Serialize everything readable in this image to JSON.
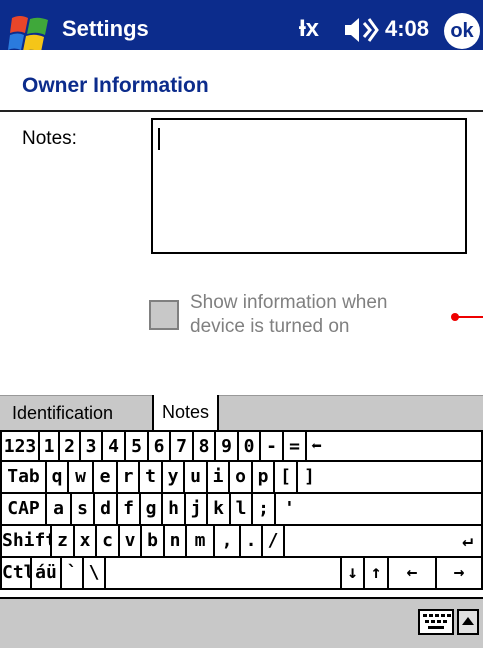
{
  "titlebar": {
    "title": "Settings",
    "time": "4:08",
    "ok_label": "ok",
    "connectivity": "Ɨx"
  },
  "page": {
    "header": "Owner Information"
  },
  "notes": {
    "label": "Notes:",
    "value": ""
  },
  "checkbox": {
    "line1": "Show information when",
    "line2": "device is turned on",
    "checked": false
  },
  "tabs": [
    {
      "label": "Identification",
      "active": false
    },
    {
      "label": "Notes",
      "active": true
    }
  ],
  "keyboard": {
    "rows": [
      [
        "123",
        "1",
        "2",
        "3",
        "4",
        "5",
        "6",
        "7",
        "8",
        "9",
        "0",
        "-",
        "=",
        "⬅"
      ],
      [
        "Tab",
        "q",
        "w",
        "e",
        "r",
        "t",
        "y",
        "u",
        "i",
        "o",
        "p",
        "[",
        "]"
      ],
      [
        "CAP",
        "a",
        "s",
        "d",
        "f",
        "g",
        "h",
        "j",
        "k",
        "l",
        ";",
        "'"
      ],
      [
        "Shift",
        "z",
        "x",
        "c",
        "v",
        "b",
        "n",
        "m",
        ",",
        ".",
        "/",
        "↵"
      ],
      [
        "Ctl",
        "áü",
        "`",
        "\\",
        "",
        "↓",
        "↑",
        "←",
        "→"
      ]
    ]
  },
  "colors": {
    "titlebar": "#0c2c8c",
    "header_text": "#0c2c8c",
    "bars": "#c8c8c8",
    "accent_red": "#e00000"
  }
}
